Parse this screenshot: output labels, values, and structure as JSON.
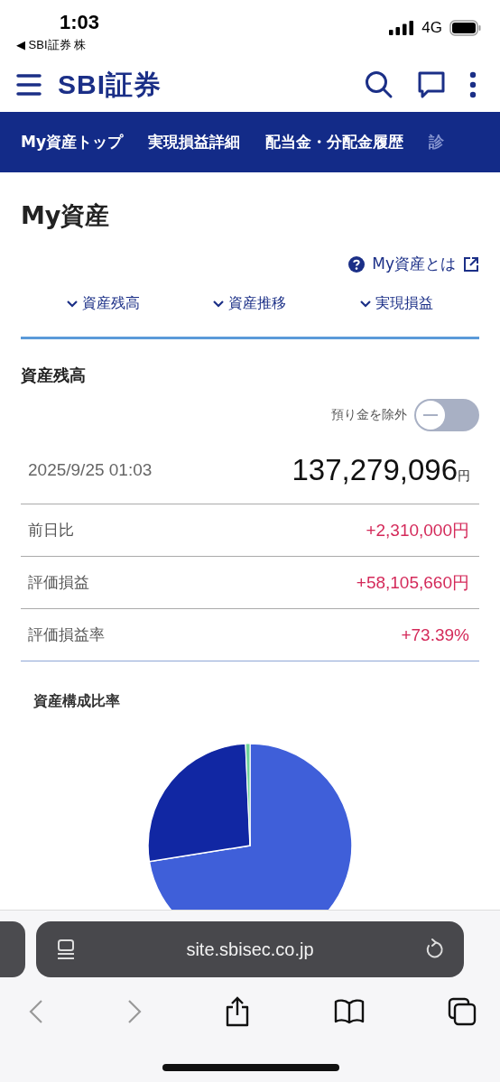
{
  "status_bar": {
    "time": "1:03",
    "back_app": "◀ SBI証券 株",
    "network": "4G"
  },
  "header": {
    "logo": "SBI証券"
  },
  "nav_tabs": [
    "My資産トップ",
    "実現損益詳細",
    "配当金・分配金履歴",
    "診"
  ],
  "page_title": "My資産",
  "help_link": "My資産とは",
  "anchors": [
    "資産残高",
    "資産推移",
    "実現損益"
  ],
  "section_title": "資産残高",
  "toggle": {
    "label": "預り金を除外",
    "on": false
  },
  "total": {
    "date": "2025/9/25 01:03",
    "amount": "137,279,096",
    "unit": "円"
  },
  "rows": [
    {
      "label": "前日比",
      "value": "+2,310,000円"
    },
    {
      "label": "評価損益",
      "value": "+58,105,660円"
    },
    {
      "label": "評価損益率",
      "value": "+73.39%"
    }
  ],
  "chart_title": "資産構成比率",
  "browser": {
    "url": "site.sbisec.co.jp"
  }
}
